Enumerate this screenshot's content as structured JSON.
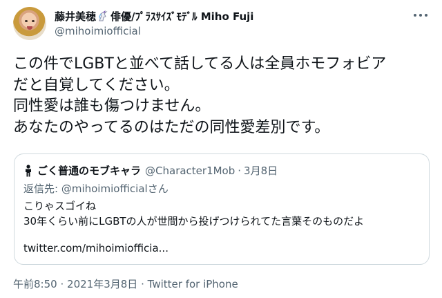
{
  "author": {
    "display_name_prefix": "藤井美穂",
    "display_name_suffix": "俳優/ﾌﾟﾗｽｻｲｽﾞﾓﾃﾞﾙ Miho Fuji",
    "handle": "@mihoimiofficial",
    "badge_icon": "unicorn-icon"
  },
  "tweet": {
    "lines": [
      "この件でLGBTと並べて話してる人は全員ホモフォビア",
      "だと自覚してください。",
      "同性愛は誰も傷つけません。",
      "あなたのやってるのはただの同性愛差別です。"
    ]
  },
  "quote": {
    "icon": "person-icon",
    "name": "ごく普通のモブキャラ",
    "handle": "@Character1Mob",
    "separator": "·",
    "date": "3月8日",
    "reply_prefix": "返信先:",
    "reply_to": "@mihoimiofficialさん",
    "body_lines": [
      "こりゃスゴイね",
      "30年くらい前にLGBTの人が世間から投げつけられてた言葉そのものだよ"
    ],
    "link": "twitter.com/mihoimiofficia..."
  },
  "footer": {
    "time": "午前8:50",
    "separator": "·",
    "date": "2021年3月8日",
    "source": "Twitter for iPhone"
  }
}
